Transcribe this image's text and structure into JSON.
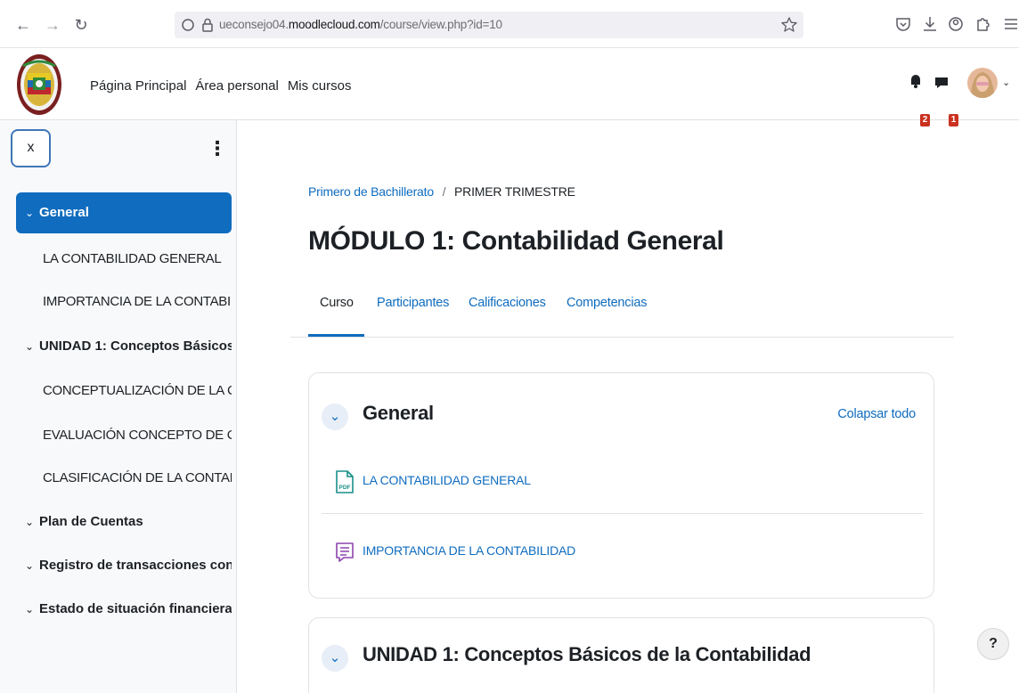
{
  "browser": {
    "url_prefix": "ueconsejo04.",
    "url_domain": "moodlecloud.com",
    "url_path": "/course/view.php?id=10"
  },
  "navbar": {
    "items": [
      "Página Principal",
      "Área personal",
      "Mis cursos"
    ],
    "notifications_count": "2",
    "messages_count": "1"
  },
  "drawer": {
    "close_label": "x",
    "menu_label": "⋮",
    "items": [
      {
        "type": "section",
        "label": "General",
        "active": true,
        "chevron": "⌄"
      },
      {
        "type": "child",
        "label": "LA CONTABILIDAD GENERAL"
      },
      {
        "type": "child",
        "label": "IMPORTANCIA DE LA CONTABILI..."
      },
      {
        "type": "section",
        "label": "UNIDAD 1: Conceptos Básicos ...",
        "chevron": "⌄"
      },
      {
        "type": "child",
        "label": "CONCEPTUALIZACIÓN DE LA CO..."
      },
      {
        "type": "child",
        "label": "EVALUACIÓN CONCEPTO DE CO..."
      },
      {
        "type": "child",
        "label": "CLASIFICACIÓN DE LA CONTABI..."
      },
      {
        "type": "section",
        "label": "Plan de Cuentas",
        "chevron": "⌄"
      },
      {
        "type": "section",
        "label": "Registro de transacciones cont...",
        "chevron": "⌄"
      },
      {
        "type": "section",
        "label": "Estado de situación financiera",
        "chevron": "⌄"
      }
    ]
  },
  "breadcrumb": {
    "course": "Primero de Bachillerato",
    "separator": "/",
    "current": "PRIMER TRIMESTRE"
  },
  "page_title": "MÓDULO 1: Contabilidad General",
  "tabs": [
    "Curso",
    "Participantes",
    "Calificaciones",
    "Competencias"
  ],
  "sections": [
    {
      "title": "General",
      "collapse_all": "Colapsar todo",
      "activities": [
        {
          "type": "pdf",
          "icon": "pdf-icon",
          "label": "LA CONTABILIDAD GENERAL"
        },
        {
          "type": "forum",
          "icon": "forum-icon",
          "label": "IMPORTANCIA DE LA CONTABILIDAD"
        }
      ]
    },
    {
      "title": "UNIDAD 1: Conceptos Básicos de la Contabilidad"
    }
  ],
  "help_label": "?",
  "colors": {
    "brand": "#0f6cbf",
    "badge": "#ca3120",
    "pdf_icon": "#1a8f8a",
    "forum_icon": "#8e44ad"
  }
}
